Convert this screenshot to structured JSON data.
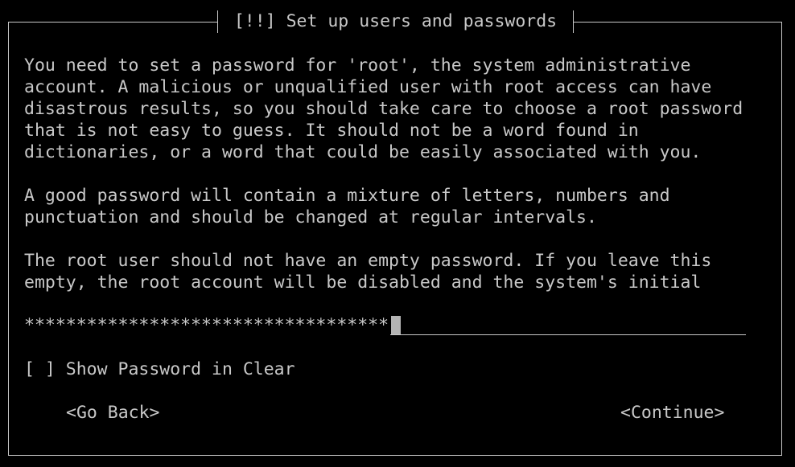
{
  "dialog": {
    "title": "[!!] Set up users and passwords",
    "paragraph1": [
      "You need to set a password for 'root', the system administrative",
      "account. A malicious or unqualified user with root access can have",
      "disastrous results, so you should take care to choose a root password",
      "that is not easy to guess. It should not be a word found in",
      "dictionaries, or a word that could be easily associated with you."
    ],
    "paragraph2": [
      "A good password will contain a mixture of letters, numbers and",
      "punctuation and should be changed at regular intervals."
    ],
    "paragraph3": [
      "The root user should not have an empty password. If you leave this",
      "empty, the root account will be disabled and the system's initial"
    ],
    "password_field": {
      "masked_value": "***********************************"
    },
    "show_password_checkbox": {
      "box": "[ ]",
      "label": "Show Password in Clear"
    },
    "buttons": {
      "go_back": "<Go Back>",
      "continue": "<Continue>"
    }
  }
}
